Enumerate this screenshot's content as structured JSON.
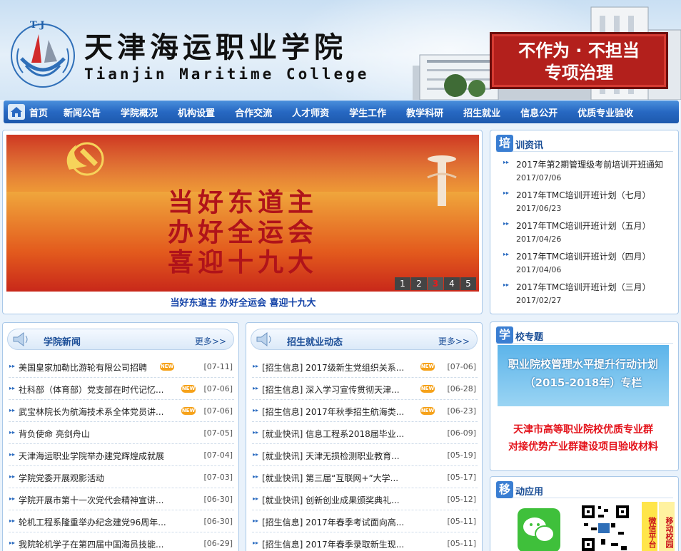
{
  "header": {
    "logo_text": "T·J",
    "college_cn": "天津海运职业学院",
    "college_en": "Tianjin Maritime College",
    "campaign_line1": "不作为 · 不担当",
    "campaign_line2": "专项治理"
  },
  "nav": {
    "items": [
      "首页",
      "新闻公告",
      "学院概况",
      "机构设置",
      "合作交流",
      "人才师资",
      "学生工作",
      "教学科研",
      "招生就业",
      "信息公开",
      "优质专业验收"
    ]
  },
  "slider": {
    "lines": [
      "当好东道主",
      "办好全运会",
      "喜迎十九大"
    ],
    "dots": [
      "1",
      "2",
      "3",
      "4",
      "5"
    ],
    "active_dot": "3",
    "caption": "当好东道主  办好全运会  喜迎十九大"
  },
  "training": {
    "badge": "培",
    "title_rest": "训资讯",
    "items": [
      {
        "title": "2017年第2期管理级考前培训开班通知",
        "date": "2017/07/06"
      },
      {
        "title": "2017年TMC培训开班计划（七月）",
        "date": "2017/06/23"
      },
      {
        "title": "2017年TMC培训开班计划（五月）",
        "date": "2017/04/26"
      },
      {
        "title": "2017年TMC培训开班计划（四月）",
        "date": "2017/04/06"
      },
      {
        "title": "2017年TMC培训开班计划（三月）",
        "date": "2017/02/27"
      }
    ]
  },
  "special": {
    "badge": "学",
    "title_rest": "校专题",
    "banner1_line1": "职业院校管理水平提升行动计划",
    "banner1_line2": "（2015-2018年）专栏",
    "banner2_line1": "天津市高等职业院校优质专业群",
    "banner2_line2": "对接优势产业群建设项目验收材料"
  },
  "mobile": {
    "badge": "移",
    "title_rest": "动应用",
    "tag1": "微信平台",
    "tag2": "移动校园"
  },
  "college_news": {
    "title": "学院新闻",
    "more": "更多>>",
    "new_label": "NEW",
    "rows": [
      {
        "text": "美国皇家加勒比游轮有限公司招聘",
        "date": "[07-11]",
        "new": true
      },
      {
        "text": "社科部（体育部）党支部在时代记忆...",
        "date": "[07-06]",
        "new": true
      },
      {
        "text": "武宝林院长为航海技术系全体党员讲...",
        "date": "[07-06]",
        "new": true
      },
      {
        "text": "背负使命 亮剑舟山",
        "date": "[07-05]",
        "new": false
      },
      {
        "text": "天津海运职业学院举办建党辉煌成就展",
        "date": "[07-04]",
        "new": false
      },
      {
        "text": "学院党委开展观影活动",
        "date": "[07-03]",
        "new": false
      },
      {
        "text": "学院开展市第十一次党代会精神宣讲...",
        "date": "[06-30]",
        "new": false
      },
      {
        "text": "轮机工程系隆重举办纪念建党96周年...",
        "date": "[06-30]",
        "new": false
      },
      {
        "text": "我院轮机学子在第四届中国海员技能...",
        "date": "[06-29]",
        "new": false
      }
    ]
  },
  "job_news": {
    "title": "招生就业动态",
    "more": "更多>>",
    "new_label": "NEW",
    "rows": [
      {
        "text": "[招生信息] 2017级新生党组织关系...",
        "date": "[07-06]",
        "new": true
      },
      {
        "text": "[招生信息] 深入学习宣传贯彻天津...",
        "date": "[06-28]",
        "new": true
      },
      {
        "text": "[招生信息] 2017年秋季招生航海类...",
        "date": "[06-23]",
        "new": true
      },
      {
        "text": "[就业快讯] 信息工程系2018届毕业...",
        "date": "[06-09]",
        "new": false
      },
      {
        "text": "[就业快讯] 天津无损检测职业教育...",
        "date": "[05-19]",
        "new": false
      },
      {
        "text": "[就业快讯] 第三届“互联网+”大学...",
        "date": "[05-17]",
        "new": false
      },
      {
        "text": "[就业快讯] 创新创业成果颁奖典礼...",
        "date": "[05-12]",
        "new": false
      },
      {
        "text": "[招生信息] 2017年春季考试面向高...",
        "date": "[05-11]",
        "new": false
      },
      {
        "text": "[招生信息] 2017年春季录取新生现...",
        "date": "[05-11]",
        "new": false
      }
    ]
  },
  "colors": {
    "nav": "#2768c2",
    "accent": "#1d4f98",
    "banner_red": "#b3201c",
    "new_badge": "#f6a21a"
  }
}
